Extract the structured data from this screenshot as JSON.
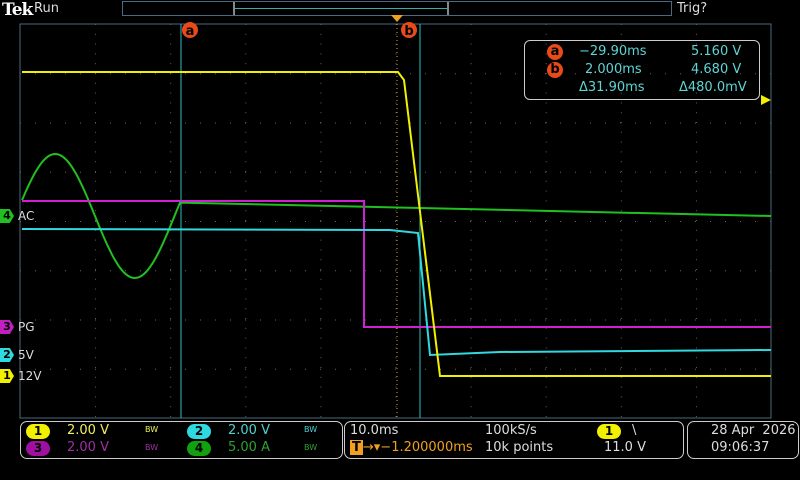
{
  "header": {
    "brand": "Tek",
    "state": "Run",
    "trigger_status": "Trig?"
  },
  "cursors": {
    "a": {
      "label": "a",
      "time": "−29.90ms",
      "value": "5.160 V"
    },
    "b": {
      "label": "b",
      "time": "2.000ms",
      "value": "4.680 V"
    },
    "delta": {
      "time": "Δ31.90ms",
      "value": "Δ480.0mV"
    }
  },
  "channels": [
    {
      "num": "1",
      "label": "12V",
      "scale": "2.00 V",
      "bw": "BW",
      "color": "#f0f000"
    },
    {
      "num": "2",
      "label": "5V",
      "scale": "2.00 V",
      "bw": "BW",
      "color": "#30d8e0"
    },
    {
      "num": "3",
      "label": "PG",
      "scale": "2.00 V",
      "bw": "BW",
      "color": "#c020c0"
    },
    {
      "num": "4",
      "label": "AC",
      "scale": "5.00 A",
      "bw": "BW",
      "color": "#20c020"
    }
  ],
  "horizontal": {
    "scale": "10.0ms",
    "sample_rate": "100kS/s",
    "position": "−1.200000ms",
    "record_length": "10k points"
  },
  "trigger": {
    "source": "1",
    "slope": "\\",
    "level": "11.0 V",
    "marker": "T"
  },
  "datetime": {
    "date": "28 Apr  2026",
    "time": "09:06:37"
  }
}
